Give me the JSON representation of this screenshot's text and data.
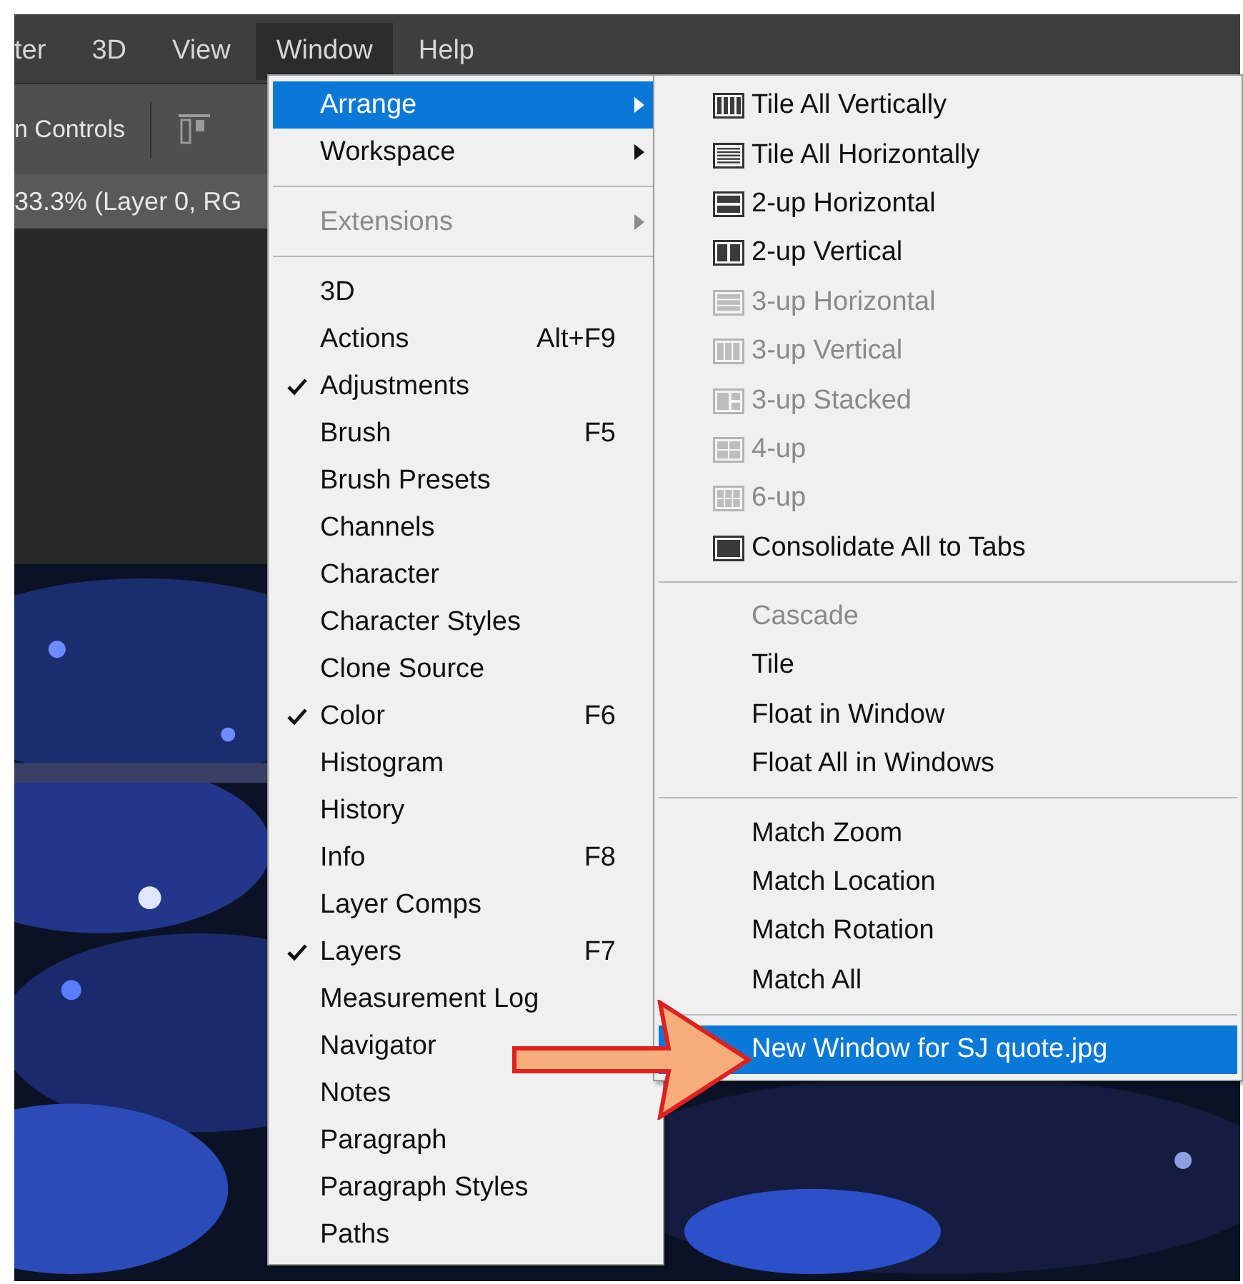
{
  "menu_bar": [
    {
      "label": "ter",
      "selected": false
    },
    {
      "label": "3D",
      "selected": false
    },
    {
      "label": "View",
      "selected": false
    },
    {
      "label": "Window",
      "selected": true
    },
    {
      "label": "Help",
      "selected": false
    }
  ],
  "options_bar": {
    "label": "n Controls"
  },
  "document_tab": {
    "title": "33.3% (Layer 0, RG"
  },
  "window_menu": {
    "items": [
      {
        "kind": "submenu",
        "label": "Arrange",
        "selected": true,
        "disabled": false,
        "checked": false
      },
      {
        "kind": "submenu",
        "label": "Workspace",
        "selected": false,
        "disabled": false,
        "checked": false
      },
      {
        "kind": "separator"
      },
      {
        "kind": "submenu",
        "label": "Extensions",
        "selected": false,
        "disabled": true,
        "checked": false
      },
      {
        "kind": "separator"
      },
      {
        "kind": "item",
        "label": "3D",
        "selected": false,
        "disabled": false,
        "checked": false
      },
      {
        "kind": "item",
        "label": "Actions",
        "shortcut": "Alt+F9",
        "selected": false,
        "disabled": false,
        "checked": false
      },
      {
        "kind": "item",
        "label": "Adjustments",
        "selected": false,
        "disabled": false,
        "checked": true
      },
      {
        "kind": "item",
        "label": "Brush",
        "shortcut": "F5",
        "selected": false,
        "disabled": false,
        "checked": false
      },
      {
        "kind": "item",
        "label": "Brush Presets",
        "selected": false,
        "disabled": false,
        "checked": false
      },
      {
        "kind": "item",
        "label": "Channels",
        "selected": false,
        "disabled": false,
        "checked": false
      },
      {
        "kind": "item",
        "label": "Character",
        "selected": false,
        "disabled": false,
        "checked": false
      },
      {
        "kind": "item",
        "label": "Character Styles",
        "selected": false,
        "disabled": false,
        "checked": false
      },
      {
        "kind": "item",
        "label": "Clone Source",
        "selected": false,
        "disabled": false,
        "checked": false
      },
      {
        "kind": "item",
        "label": "Color",
        "shortcut": "F6",
        "selected": false,
        "disabled": false,
        "checked": true
      },
      {
        "kind": "item",
        "label": "Histogram",
        "selected": false,
        "disabled": false,
        "checked": false
      },
      {
        "kind": "item",
        "label": "History",
        "selected": false,
        "disabled": false,
        "checked": false
      },
      {
        "kind": "item",
        "label": "Info",
        "shortcut": "F8",
        "selected": false,
        "disabled": false,
        "checked": false
      },
      {
        "kind": "item",
        "label": "Layer Comps",
        "selected": false,
        "disabled": false,
        "checked": false
      },
      {
        "kind": "item",
        "label": "Layers",
        "shortcut": "F7",
        "selected": false,
        "disabled": false,
        "checked": true
      },
      {
        "kind": "item",
        "label": "Measurement Log",
        "selected": false,
        "disabled": false,
        "checked": false
      },
      {
        "kind": "item",
        "label": "Navigator",
        "selected": false,
        "disabled": false,
        "checked": false
      },
      {
        "kind": "item",
        "label": "Notes",
        "selected": false,
        "disabled": false,
        "checked": false
      },
      {
        "kind": "item",
        "label": "Paragraph",
        "selected": false,
        "disabled": false,
        "checked": false
      },
      {
        "kind": "item",
        "label": "Paragraph Styles",
        "selected": false,
        "disabled": false,
        "checked": false
      },
      {
        "kind": "item",
        "label": "Paths",
        "selected": false,
        "disabled": false,
        "checked": false
      }
    ]
  },
  "arrange_submenu": {
    "items": [
      {
        "kind": "layout",
        "label": "Tile All Vertically",
        "selected": false,
        "disabled": false
      },
      {
        "kind": "layout",
        "label": "Tile All Horizontally",
        "selected": false,
        "disabled": false
      },
      {
        "kind": "layout",
        "label": "2-up Horizontal",
        "selected": false,
        "disabled": false
      },
      {
        "kind": "layout",
        "label": "2-up Vertical",
        "selected": false,
        "disabled": false
      },
      {
        "kind": "layout",
        "label": "3-up Horizontal",
        "selected": false,
        "disabled": true
      },
      {
        "kind": "layout",
        "label": "3-up Vertical",
        "selected": false,
        "disabled": true
      },
      {
        "kind": "layout",
        "label": "3-up Stacked",
        "selected": false,
        "disabled": true
      },
      {
        "kind": "layout",
        "label": "4-up",
        "selected": false,
        "disabled": true
      },
      {
        "kind": "layout",
        "label": "6-up",
        "selected": false,
        "disabled": true
      },
      {
        "kind": "layout",
        "label": "Consolidate All to Tabs",
        "selected": false,
        "disabled": false
      },
      {
        "kind": "separator"
      },
      {
        "kind": "item",
        "label": "Cascade",
        "selected": false,
        "disabled": true
      },
      {
        "kind": "item",
        "label": "Tile",
        "selected": false,
        "disabled": false
      },
      {
        "kind": "item",
        "label": "Float in Window",
        "selected": false,
        "disabled": false
      },
      {
        "kind": "item",
        "label": "Float All in Windows",
        "selected": false,
        "disabled": false
      },
      {
        "kind": "separator"
      },
      {
        "kind": "item",
        "label": "Match Zoom",
        "selected": false,
        "disabled": false
      },
      {
        "kind": "item",
        "label": "Match Location",
        "selected": false,
        "disabled": false
      },
      {
        "kind": "item",
        "label": "Match Rotation",
        "selected": false,
        "disabled": false
      },
      {
        "kind": "item",
        "label": "Match All",
        "selected": false,
        "disabled": false
      },
      {
        "kind": "separator"
      },
      {
        "kind": "item",
        "label": "New Window for SJ quote.jpg",
        "selected": true,
        "disabled": false
      }
    ]
  }
}
